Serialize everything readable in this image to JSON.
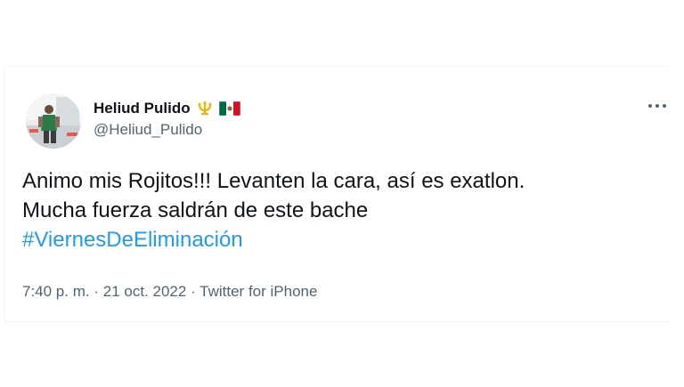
{
  "tweet": {
    "author": {
      "display_name": "Heliud Pulido",
      "handle": "@Heliud_Pulido",
      "badges": [
        "trident-emoji",
        "mexico-flag-emoji"
      ]
    },
    "more_icon": "more-horizontal-icon",
    "text_lines": [
      "Animo mis Rojitos!!! Levanten la cara, así es exatlon.",
      "Mucha fuerza saldrán de este bache"
    ],
    "hashtag": "#ViernesDeEliminación",
    "meta": {
      "time": "7:40 p. m.",
      "separator": "·",
      "date": "21 oct. 2022",
      "source": "Twitter for iPhone"
    },
    "colors": {
      "hashtag": "#1d9bf0",
      "secondary_text": "#536471",
      "primary_text": "#0f1419"
    }
  }
}
